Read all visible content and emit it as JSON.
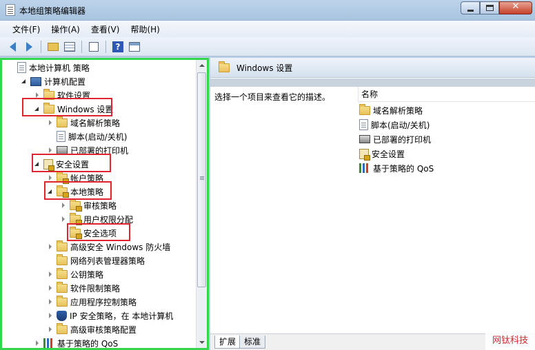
{
  "window": {
    "title": "本地组策略编辑器",
    "close_glyph": "✕"
  },
  "menu": [
    "文件(F)",
    "操作(A)",
    "查看(V)",
    "帮助(H)"
  ],
  "toolbar": {
    "help_glyph": "?"
  },
  "tree": [
    {
      "label": "本地计算机 策略",
      "icon": "doc-icon",
      "indent": 0,
      "expander": "none"
    },
    {
      "label": "计算机配置",
      "icon": "computer-icon",
      "indent": 1,
      "expander": "open"
    },
    {
      "label": "软件设置",
      "icon": "folder-icon",
      "indent": 2,
      "expander": "closed"
    },
    {
      "label": "Windows 设置",
      "icon": "folder-icon",
      "indent": 2,
      "expander": "open"
    },
    {
      "label": "域名解析策略",
      "icon": "folder-icon",
      "indent": 3,
      "expander": "closed"
    },
    {
      "label": "脚本(启动/关机)",
      "icon": "doc-icon",
      "indent": 3,
      "expander": "none"
    },
    {
      "label": "已部署的打印机",
      "icon": "printer-icon",
      "indent": 3,
      "expander": "closed"
    },
    {
      "label": "安全设置",
      "icon": "security-icon",
      "indent": 2,
      "expander": "open"
    },
    {
      "label": "帐户策略",
      "icon": "lock-folder-icon",
      "indent": 3,
      "expander": "closed"
    },
    {
      "label": "本地策略",
      "icon": "lock-folder-icon",
      "indent": 3,
      "expander": "open"
    },
    {
      "label": "审核策略",
      "icon": "lock-folder-icon",
      "indent": 4,
      "expander": "closed"
    },
    {
      "label": "用户权限分配",
      "icon": "lock-folder-icon",
      "indent": 4,
      "expander": "closed"
    },
    {
      "label": "安全选项",
      "icon": "lock-folder-icon",
      "indent": 4,
      "expander": "none"
    },
    {
      "label": "高级安全 Windows 防火墙",
      "icon": "folder-icon",
      "indent": 3,
      "expander": "closed"
    },
    {
      "label": "网络列表管理器策略",
      "icon": "folder-icon",
      "indent": 3,
      "expander": "none"
    },
    {
      "label": "公钥策略",
      "icon": "folder-icon",
      "indent": 3,
      "expander": "closed"
    },
    {
      "label": "软件限制策略",
      "icon": "folder-icon",
      "indent": 3,
      "expander": "closed"
    },
    {
      "label": "应用程序控制策略",
      "icon": "folder-icon",
      "indent": 3,
      "expander": "closed"
    },
    {
      "label": "IP 安全策略，在 本地计算机",
      "icon": "shield-icon",
      "indent": 3,
      "expander": "closed"
    },
    {
      "label": "高级审核策略配置",
      "icon": "folder-icon",
      "indent": 3,
      "expander": "closed"
    },
    {
      "label": "基于策略的 QoS",
      "icon": "qos-icon",
      "indent": 2,
      "expander": "closed"
    }
  ],
  "right": {
    "header_title": "Windows 设置",
    "description": "选择一个项目来查看它的描述。",
    "column_name": "名称",
    "items": [
      {
        "label": "域名解析策略",
        "icon": "folder-icon"
      },
      {
        "label": "脚本(启动/关机)",
        "icon": "doc-icon"
      },
      {
        "label": "已部署的打印机",
        "icon": "printer-icon"
      },
      {
        "label": "安全设置",
        "icon": "security-icon"
      },
      {
        "label": "基于策略的 QoS",
        "icon": "qos-icon"
      }
    ],
    "tabs": [
      "扩展",
      "标准"
    ]
  },
  "watermark": "网钛科技"
}
